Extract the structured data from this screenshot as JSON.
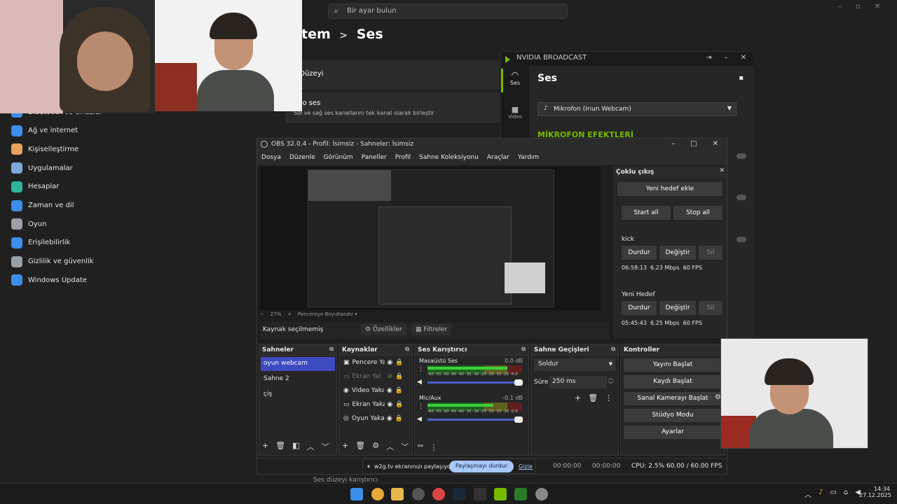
{
  "settings": {
    "search_placeholder": "Bir ayar bulun",
    "breadcrumb_parent": "tem",
    "breadcrumb_sep": ">",
    "breadcrumb_current": "Ses",
    "sidebar": [
      {
        "label": "Bluetooth ve cihazlar",
        "icon": "bluetooth-icon",
        "color": "#3b8eea"
      },
      {
        "label": "Ağ ve internet",
        "icon": "wifi-icon",
        "color": "#3b8eea"
      },
      {
        "label": "Kişiselleştirme",
        "icon": "brush-icon",
        "color": "#e8a25b"
      },
      {
        "label": "Uygulamalar",
        "icon": "apps-icon",
        "color": "#7ea7d8"
      },
      {
        "label": "Hesaplar",
        "icon": "account-icon",
        "color": "#2fb59b"
      },
      {
        "label": "Zaman ve dil",
        "icon": "globe-icon",
        "color": "#3b8eea"
      },
      {
        "label": "Oyun",
        "icon": "gamepad-icon",
        "color": "#9aa0a6"
      },
      {
        "label": "Erişilebilirlik",
        "icon": "accessibility-icon",
        "color": "#3b8eea"
      },
      {
        "label": "Gizlilik ve güvenlik",
        "icon": "shield-icon",
        "color": "#9aa0a6"
      },
      {
        "label": "Windows Update",
        "icon": "update-icon",
        "color": "#3b8eea"
      }
    ],
    "cards": [
      {
        "title": "s Düzeyi",
        "subtitle": ""
      },
      {
        "title": "ono ses",
        "subtitle": "Sol ve sağ ses kanallarını tek kanal olarak birleştir"
      }
    ],
    "footer_text": "Ses düzeyi karıştırıcı"
  },
  "nvidia": {
    "title": "NVIDIA BROADCAST",
    "nav": [
      {
        "label": "Ses"
      },
      {
        "label": "Video"
      }
    ],
    "section_title": "Ses",
    "mic_select": "Mikrofon (Irıun Webcam)",
    "effects_heading": "MİKROFON EFEKTLERİ"
  },
  "obs": {
    "title": "OBS 32.0.4 - Profil: İsimsiz - Sahneler: İsimsiz",
    "menu": [
      "Dosya",
      "Düzenle",
      "Görünüm",
      "Paneller",
      "Profil",
      "Sahne Koleksiyonu",
      "Araçlar",
      "Yardım"
    ],
    "zoom_minus": "−",
    "zoom_level": "27%",
    "zoom_plus": "+",
    "zoom_mode": "Pencereye Boyutlandır",
    "no_source": "Kaynak seçilmemiş",
    "properties": "Özellikler",
    "filters": "Filtreler",
    "docks": {
      "scenes_title": "Sahneler",
      "scenes": [
        "oyun webcam",
        "Sahne 2",
        "çiş"
      ],
      "sources_title": "Kaynaklar",
      "sources": [
        "Pencere Yal",
        "Ekran Yal",
        "Video Yakal",
        "Ekran Yakal",
        "Oyun Yakal"
      ],
      "mixer_title": "Ses Karıştırıcı",
      "mixer": [
        {
          "name": "Masaüstü Ses",
          "db": "0.0 dB",
          "level": 0.85
        },
        {
          "name": "Mic/Aux",
          "db": "-0.1 dB",
          "level": 0.7
        }
      ],
      "mixer_scale": "-60 -55 -50 -45 -40 -35 -30 -25 -20 -15 -10 -5 0",
      "transitions_title": "Sahne Geçişleri",
      "transition": "Soldur",
      "duration_label": "Süre",
      "duration": "250 ms",
      "controls_title": "Kontroller",
      "controls": [
        "Yayını Başlat",
        "Kaydı Başlat",
        "Sanal Kamerayı Başlat",
        "Stüdyo Modu",
        "Ayarlar"
      ]
    },
    "multi": {
      "title": "Çoklu çıkış",
      "add": "Yeni hedef ekle",
      "start_all": "Start all",
      "stop_all": "Stop all",
      "targets": [
        {
          "name": "kick",
          "stop": "Durdur",
          "edit": "Değiştir",
          "del": "Sil",
          "stats": "06:58:13  6.23 Mbps  60 FPS"
        },
        {
          "name": "Yeni Hedef",
          "stop": "Durdur",
          "edit": "Değiştir",
          "del": "Sil",
          "stats": "05:45:43  6.25 Mbps  60 FPS"
        }
      ]
    },
    "status": {
      "stream_time": "00:00:00",
      "rec_time": "00:00:00",
      "cpu": "CPU: 2.5%",
      "fps": "60.00 / 60.00 FPS"
    }
  },
  "share": {
    "text": "w2g.tv ekranınızı paylaşıyor.",
    "stop": "Paylaşmayı durdur",
    "hide": "Gizle"
  },
  "taskbar": {
    "time": "14:34",
    "date": "27.12.2025"
  },
  "colors": {
    "accent": "#3c4bc0",
    "nvidia": "#76b900"
  }
}
